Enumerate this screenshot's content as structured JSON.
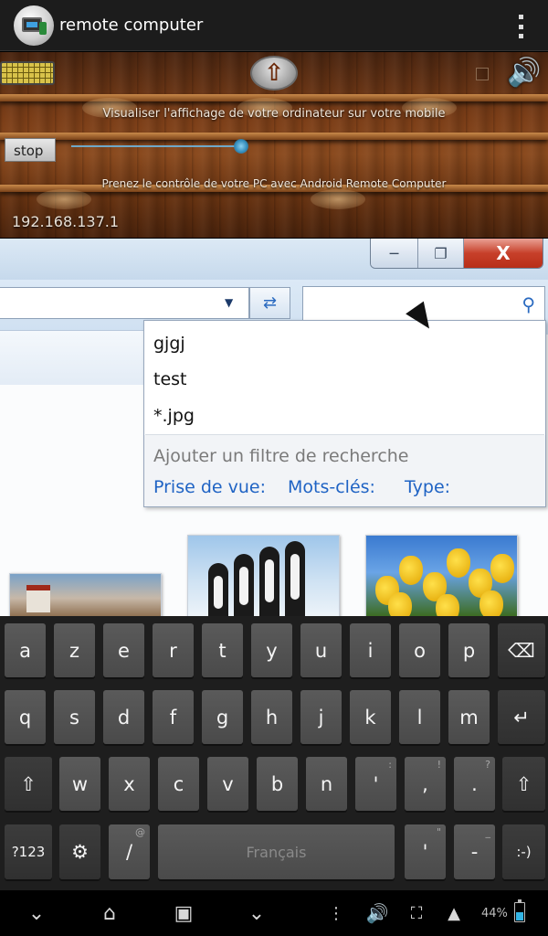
{
  "app": {
    "title": "remote computer"
  },
  "toolbar": {
    "display_label": "Visualiser l'affichage de votre ordinateur sur votre mobile",
    "stop_label": "stop",
    "control_label": "Prenez le contrôle de votre PC avec Android Remote Computer",
    "ip": "192.168.137.1"
  },
  "remote_window": {
    "caption_close": "X",
    "suggestions": [
      "gjgj",
      "test",
      "*.jpg"
    ],
    "filter_hint": "Ajouter un filtre de recherche",
    "filters": [
      "Prise de vue:",
      "Mots-clés:",
      "Type:"
    ]
  },
  "keyboard": {
    "row1": [
      "a",
      "z",
      "e",
      "r",
      "t",
      "y",
      "u",
      "i",
      "o",
      "p"
    ],
    "row2": [
      "q",
      "s",
      "d",
      "f",
      "g",
      "h",
      "j",
      "k",
      "l",
      "m"
    ],
    "row3": [
      "w",
      "x",
      "c",
      "v",
      "b",
      "n",
      "'",
      ",",
      "."
    ],
    "row3_hints": [
      "",
      "",
      "",
      "",
      "",
      "",
      "",
      ":",
      "!",
      "?"
    ],
    "symbols_key": "?123",
    "slash_key": "/",
    "slash_hint": "@",
    "space_label": "Français",
    "apostrophe_key": "'",
    "apostrophe_hint": "\"",
    "dash_key": "-",
    "dash_hint": "_",
    "smiley_key": ":-)"
  },
  "status": {
    "battery": "44%"
  },
  "colors": {
    "accent": "#33b5e5",
    "close_red": "#c7402a",
    "link_blue": "#1f63c4",
    "wood": "#7a3d17"
  }
}
